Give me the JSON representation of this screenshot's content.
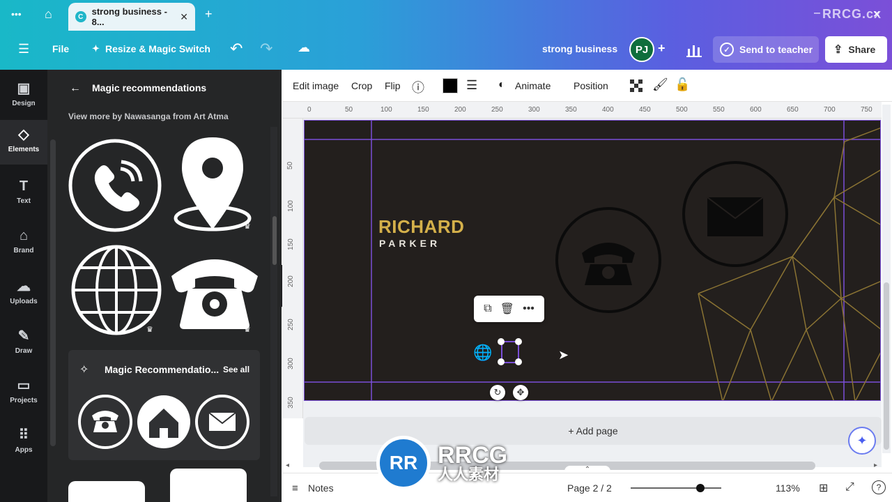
{
  "browser": {
    "tab_title": "strong business - 8...",
    "tab_close": "✕",
    "new_tab": "+",
    "dots": "•••",
    "window_min": "–",
    "window_close": "✕"
  },
  "menubar": {
    "menu": "☰",
    "file": "File",
    "resize": "Resize & Magic Switch",
    "undo": "↶",
    "redo": "↷",
    "cloud": "☁",
    "doc_title": "strong business",
    "avatar": "PJ",
    "add": "+",
    "chart": "📊",
    "send_teacher": "Send to teacher",
    "share": "Share"
  },
  "rail": {
    "items": [
      {
        "label": "Design",
        "icon": "▣"
      },
      {
        "label": "Elements",
        "icon": "◇"
      },
      {
        "label": "Text",
        "icon": "T"
      },
      {
        "label": "Brand",
        "icon": "⌂"
      },
      {
        "label": "Uploads",
        "icon": "☁"
      },
      {
        "label": "Draw",
        "icon": "✎"
      },
      {
        "label": "Projects",
        "icon": "▭"
      },
      {
        "label": "Apps",
        "icon": "⠿"
      }
    ]
  },
  "panel": {
    "back": "←",
    "title": "Magic recommendations",
    "subtitle": "View more by Nawasanga from Art Atma",
    "magic_section": "Magic Recommendatio...",
    "see_all": "See all"
  },
  "toolbar": {
    "edit_image": "Edit image",
    "crop": "Crop",
    "flip": "Flip",
    "info": "ⓘ",
    "animate": "Animate",
    "position": "Position",
    "color": "#000000"
  },
  "ruler": {
    "h": [
      "0",
      "50",
      "100",
      "150",
      "200",
      "250",
      "300",
      "350",
      "400",
      "450",
      "500",
      "550",
      "600",
      "650",
      "700",
      "750"
    ],
    "v": [
      "50",
      "100",
      "150",
      "200",
      "250",
      "300",
      "350"
    ]
  },
  "card": {
    "name": "RICHARD",
    "surname": "PARKER",
    "name_color": "#d4b04a",
    "bg_color": "#231f1d"
  },
  "canvas": {
    "add_page": "+ Add page"
  },
  "bottombar": {
    "notes": "Notes",
    "page": "Page 2 / 2",
    "zoom": "113%",
    "zoom_level_fraction": 0.77
  },
  "watermark": {
    "corner": "RRCG.cx",
    "logo": "RRCG",
    "logo_cn": "人人素材",
    "logo_mark": "RR"
  }
}
